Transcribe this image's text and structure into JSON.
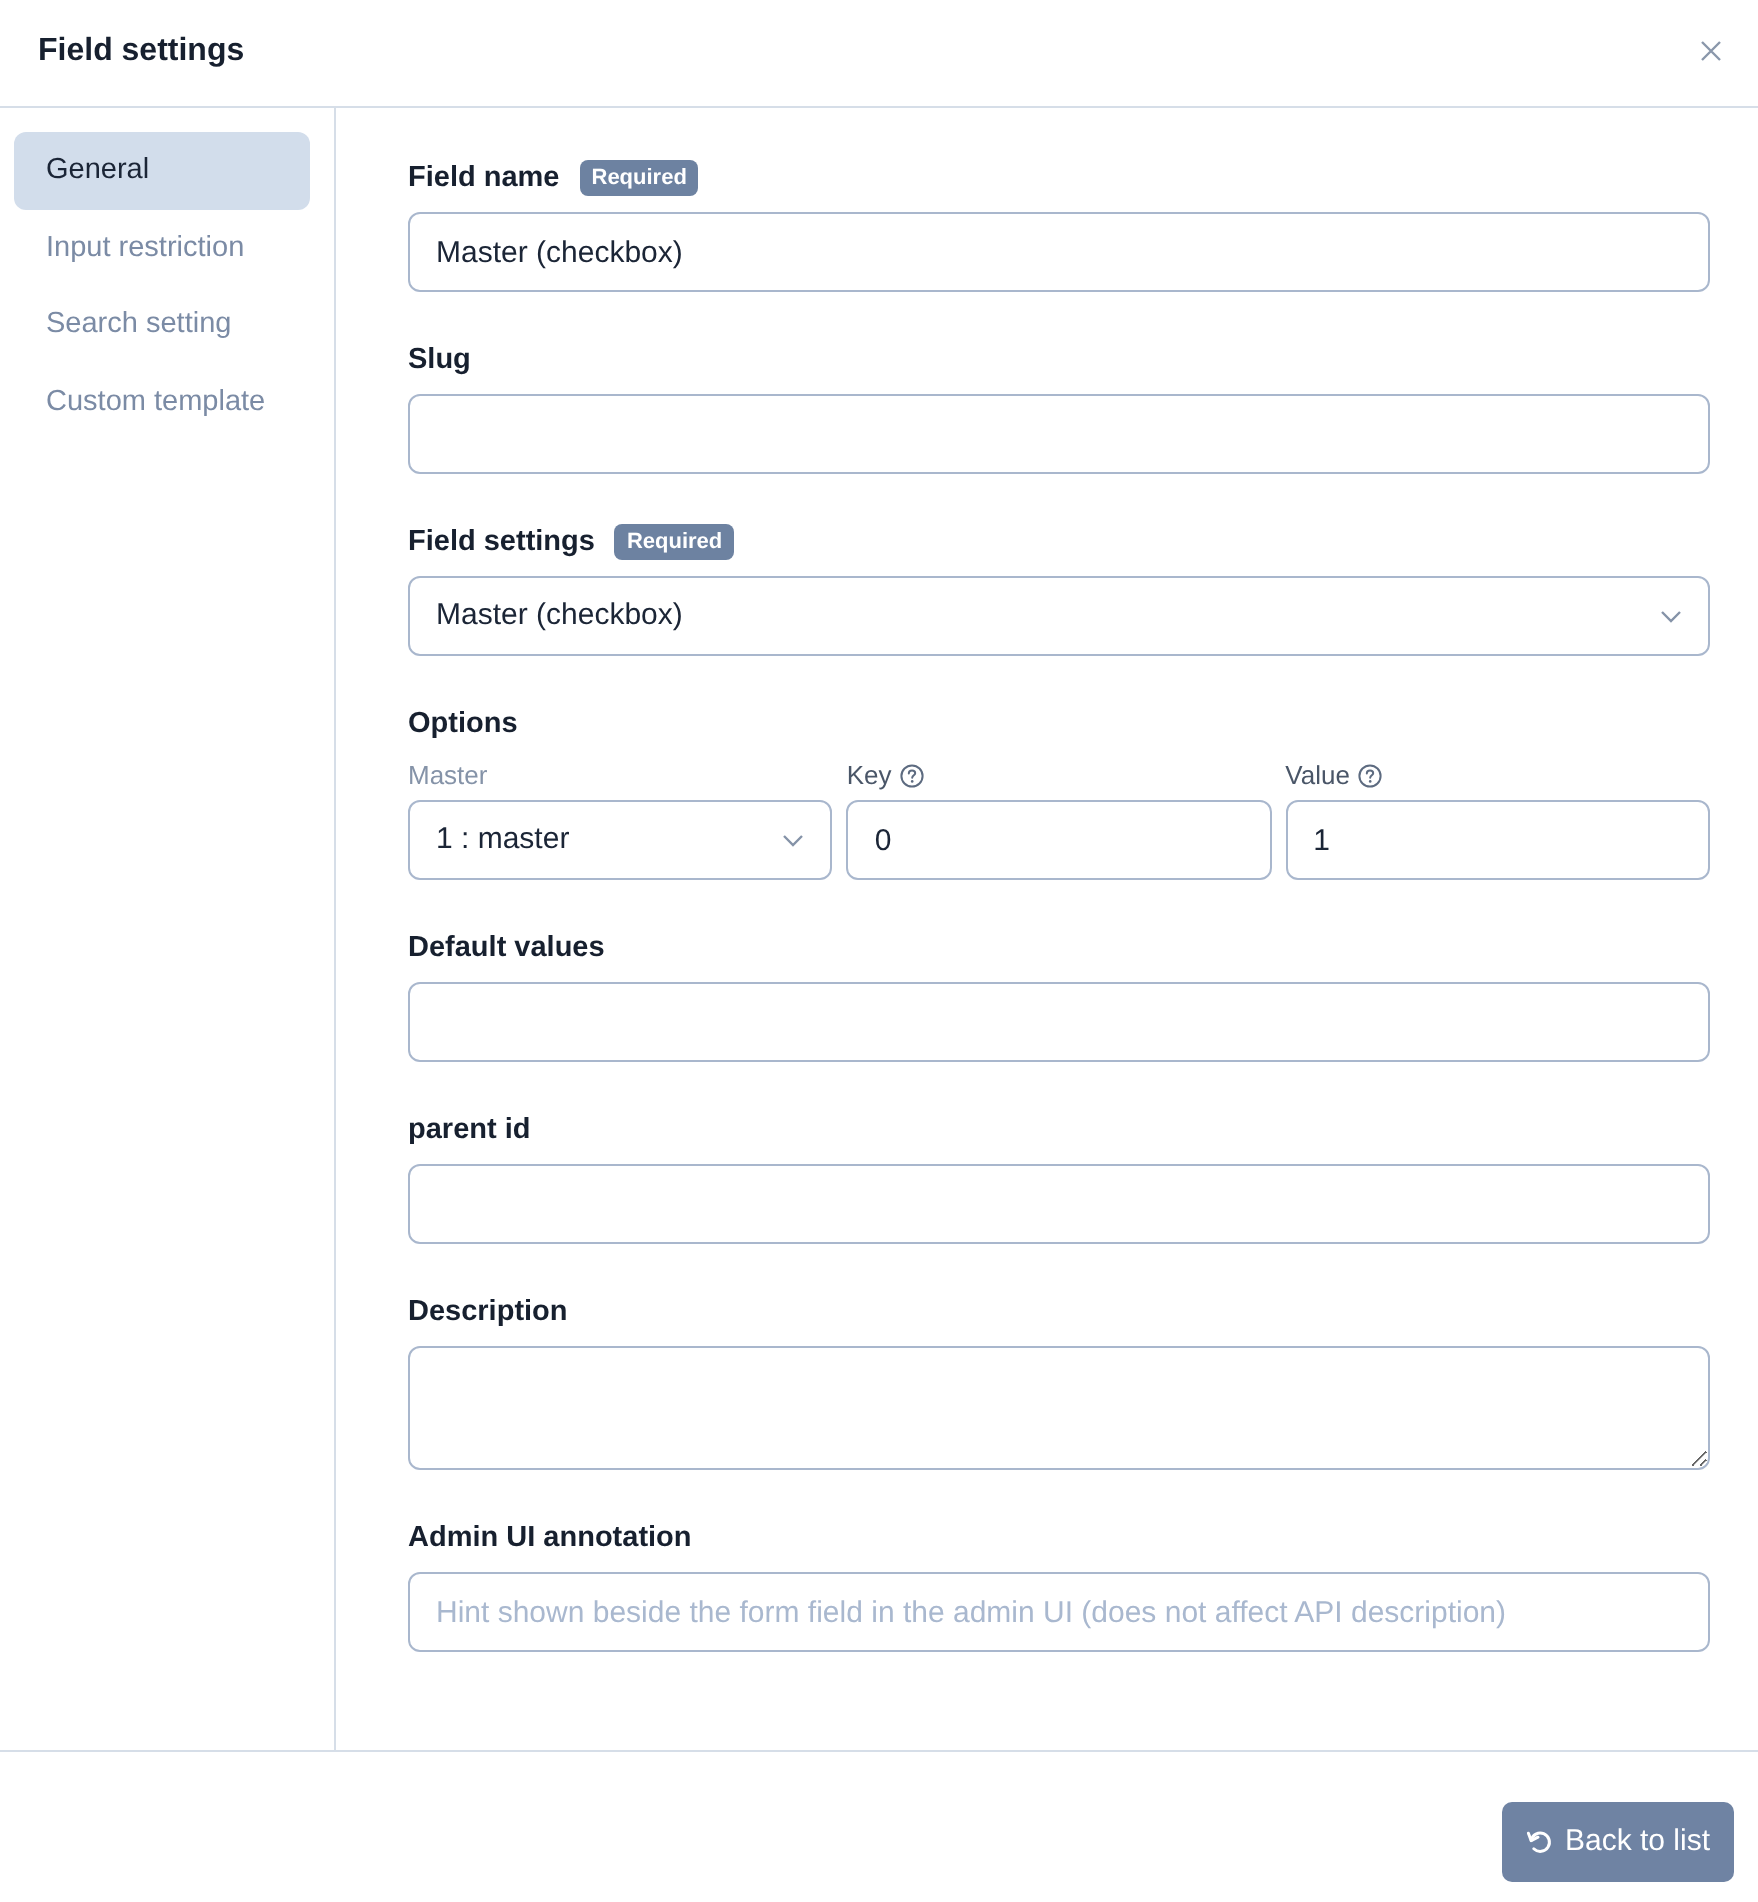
{
  "dialog": {
    "title": "Field settings"
  },
  "sidebar": {
    "items": [
      {
        "label": "General",
        "selected": true
      },
      {
        "label": "Input restriction",
        "selected": false
      },
      {
        "label": "Search setting",
        "selected": false
      },
      {
        "label": "Custom template",
        "selected": false
      }
    ]
  },
  "form": {
    "fields": [
      {
        "kind": "text",
        "label": "Field name",
        "badge": "Required",
        "value": "Master (checkbox)"
      },
      {
        "kind": "text",
        "label": "Slug"
      },
      {
        "kind": "select",
        "label": "Field settings",
        "badge": "Required",
        "value": "Master (checkbox)"
      },
      {
        "kind": "options",
        "label": "Options",
        "columns": [
          {
            "kind": "select",
            "label": "Master",
            "help": false,
            "value": "1 : master"
          },
          {
            "kind": "text",
            "label": "Key",
            "help": true,
            "value": "0"
          },
          {
            "kind": "text",
            "label": "Value",
            "help": true,
            "value": "1"
          }
        ]
      },
      {
        "kind": "text",
        "label": "Default values"
      },
      {
        "kind": "text",
        "label": "parent id"
      },
      {
        "kind": "textarea",
        "label": "Description"
      },
      {
        "kind": "text",
        "label": "Admin UI annotation",
        "placeholder": "Hint shown beside the form field in the admin UI (does not affect API description)"
      }
    ]
  },
  "footer": {
    "button": "Back to list"
  }
}
